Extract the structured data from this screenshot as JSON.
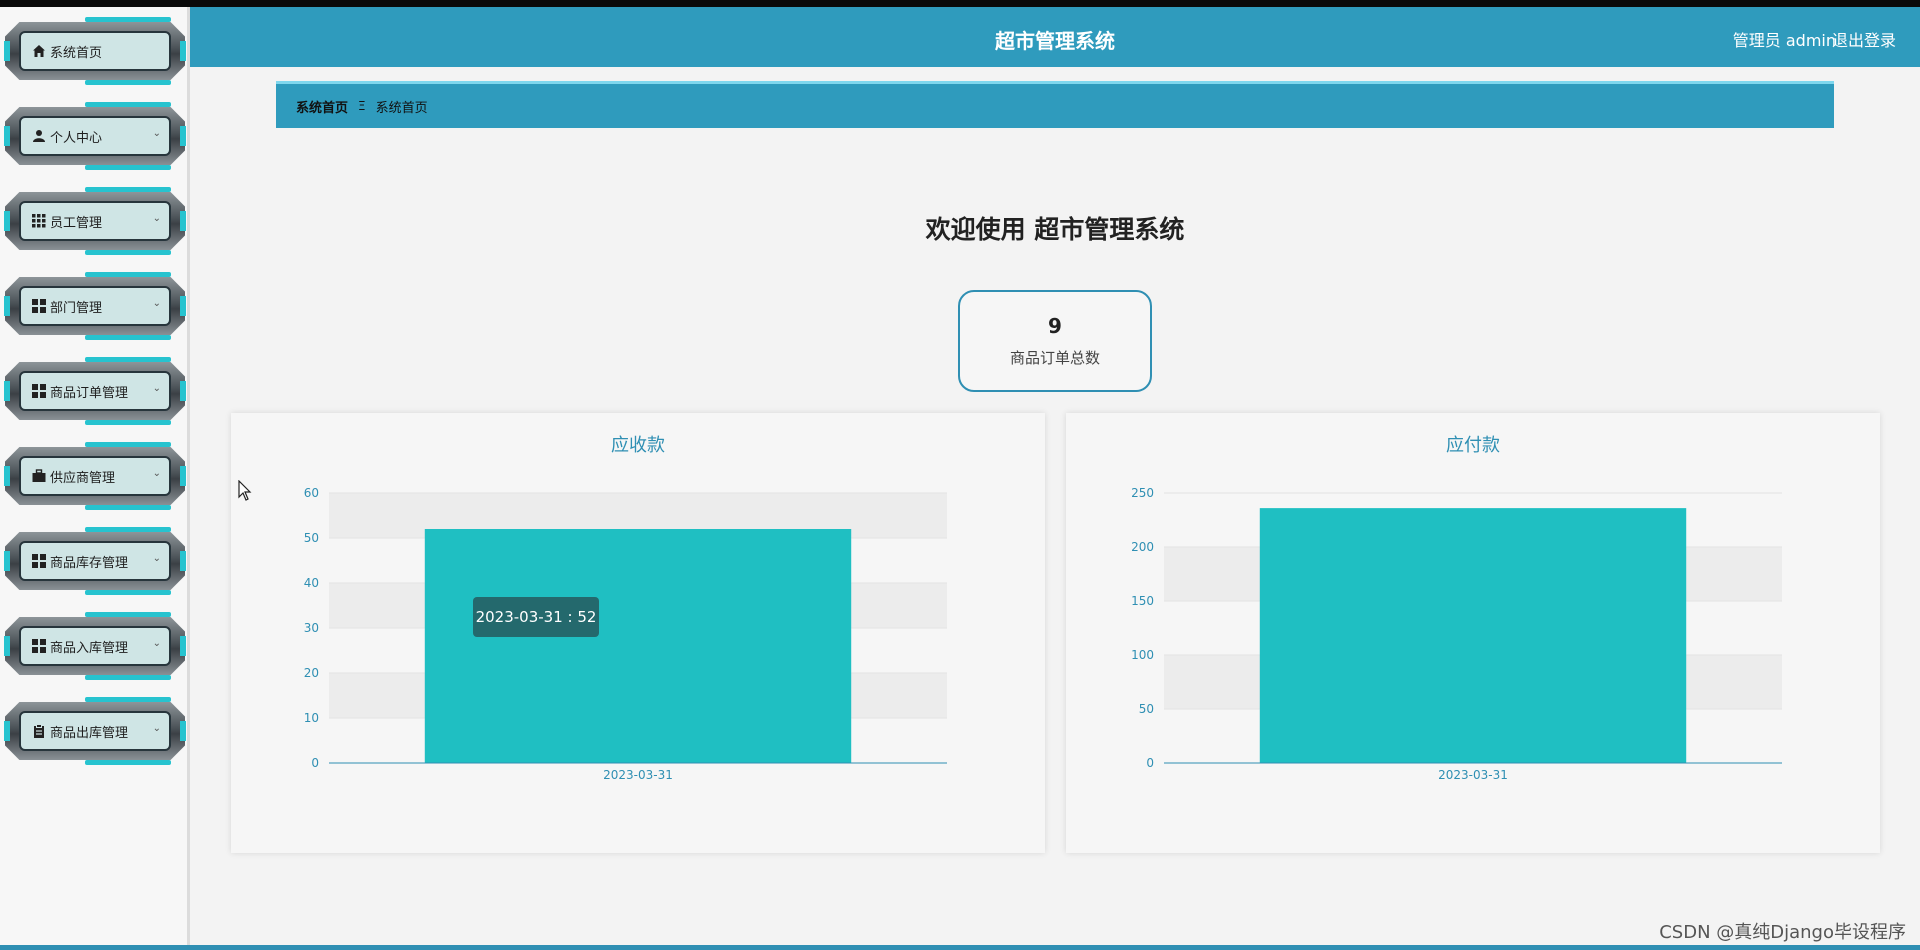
{
  "header": {
    "title": "超市管理系统",
    "user_text": "管理员 admin",
    "logout_label": "退出登录"
  },
  "sidebar": {
    "items": [
      {
        "label": "系统首页",
        "icon": "home-icon",
        "chevron": false
      },
      {
        "label": "个人中心",
        "icon": "person-icon",
        "chevron": true
      },
      {
        "label": "员工管理",
        "icon": "grid-dots-icon",
        "chevron": true
      },
      {
        "label": "部门管理",
        "icon": "grid-icon",
        "chevron": true
      },
      {
        "label": "商品订单管理",
        "icon": "grid-icon",
        "chevron": true
      },
      {
        "label": "供应商管理",
        "icon": "briefcase-icon",
        "chevron": true
      },
      {
        "label": "商品库存管理",
        "icon": "grid-icon",
        "chevron": true
      },
      {
        "label": "商品入库管理",
        "icon": "grid-icon",
        "chevron": true
      },
      {
        "label": "商品出库管理",
        "icon": "clipboard-icon",
        "chevron": true
      }
    ]
  },
  "breadcrumb": {
    "first": "系统首页",
    "separator": "Ξ",
    "second": "系统首页"
  },
  "main": {
    "welcome": "欢迎使用 超市管理系统",
    "stat": {
      "value": "9",
      "label": "商品订单总数"
    },
    "tooltip": "2023-03-31 : 52"
  },
  "colors": {
    "accent": "#2f9bbd",
    "bar": "#1fbfc2",
    "axis_text": "#2f8fb3"
  },
  "chart_data": [
    {
      "type": "bar",
      "title": "应收款",
      "categories": [
        "2023-03-31"
      ],
      "values": [
        52
      ],
      "ylim": [
        0,
        60
      ],
      "yticks": [
        0,
        10,
        20,
        30,
        40,
        50,
        60
      ],
      "xlabel": "",
      "ylabel": "",
      "grid": true
    },
    {
      "type": "bar",
      "title": "应付款",
      "categories": [
        "2023-03-31"
      ],
      "values": [
        236
      ],
      "ylim": [
        0,
        250
      ],
      "yticks": [
        0,
        50,
        100,
        150,
        200,
        250
      ],
      "xlabel": "",
      "ylabel": "",
      "grid": true
    }
  ],
  "watermark": "CSDN @真纯Django毕设程序"
}
